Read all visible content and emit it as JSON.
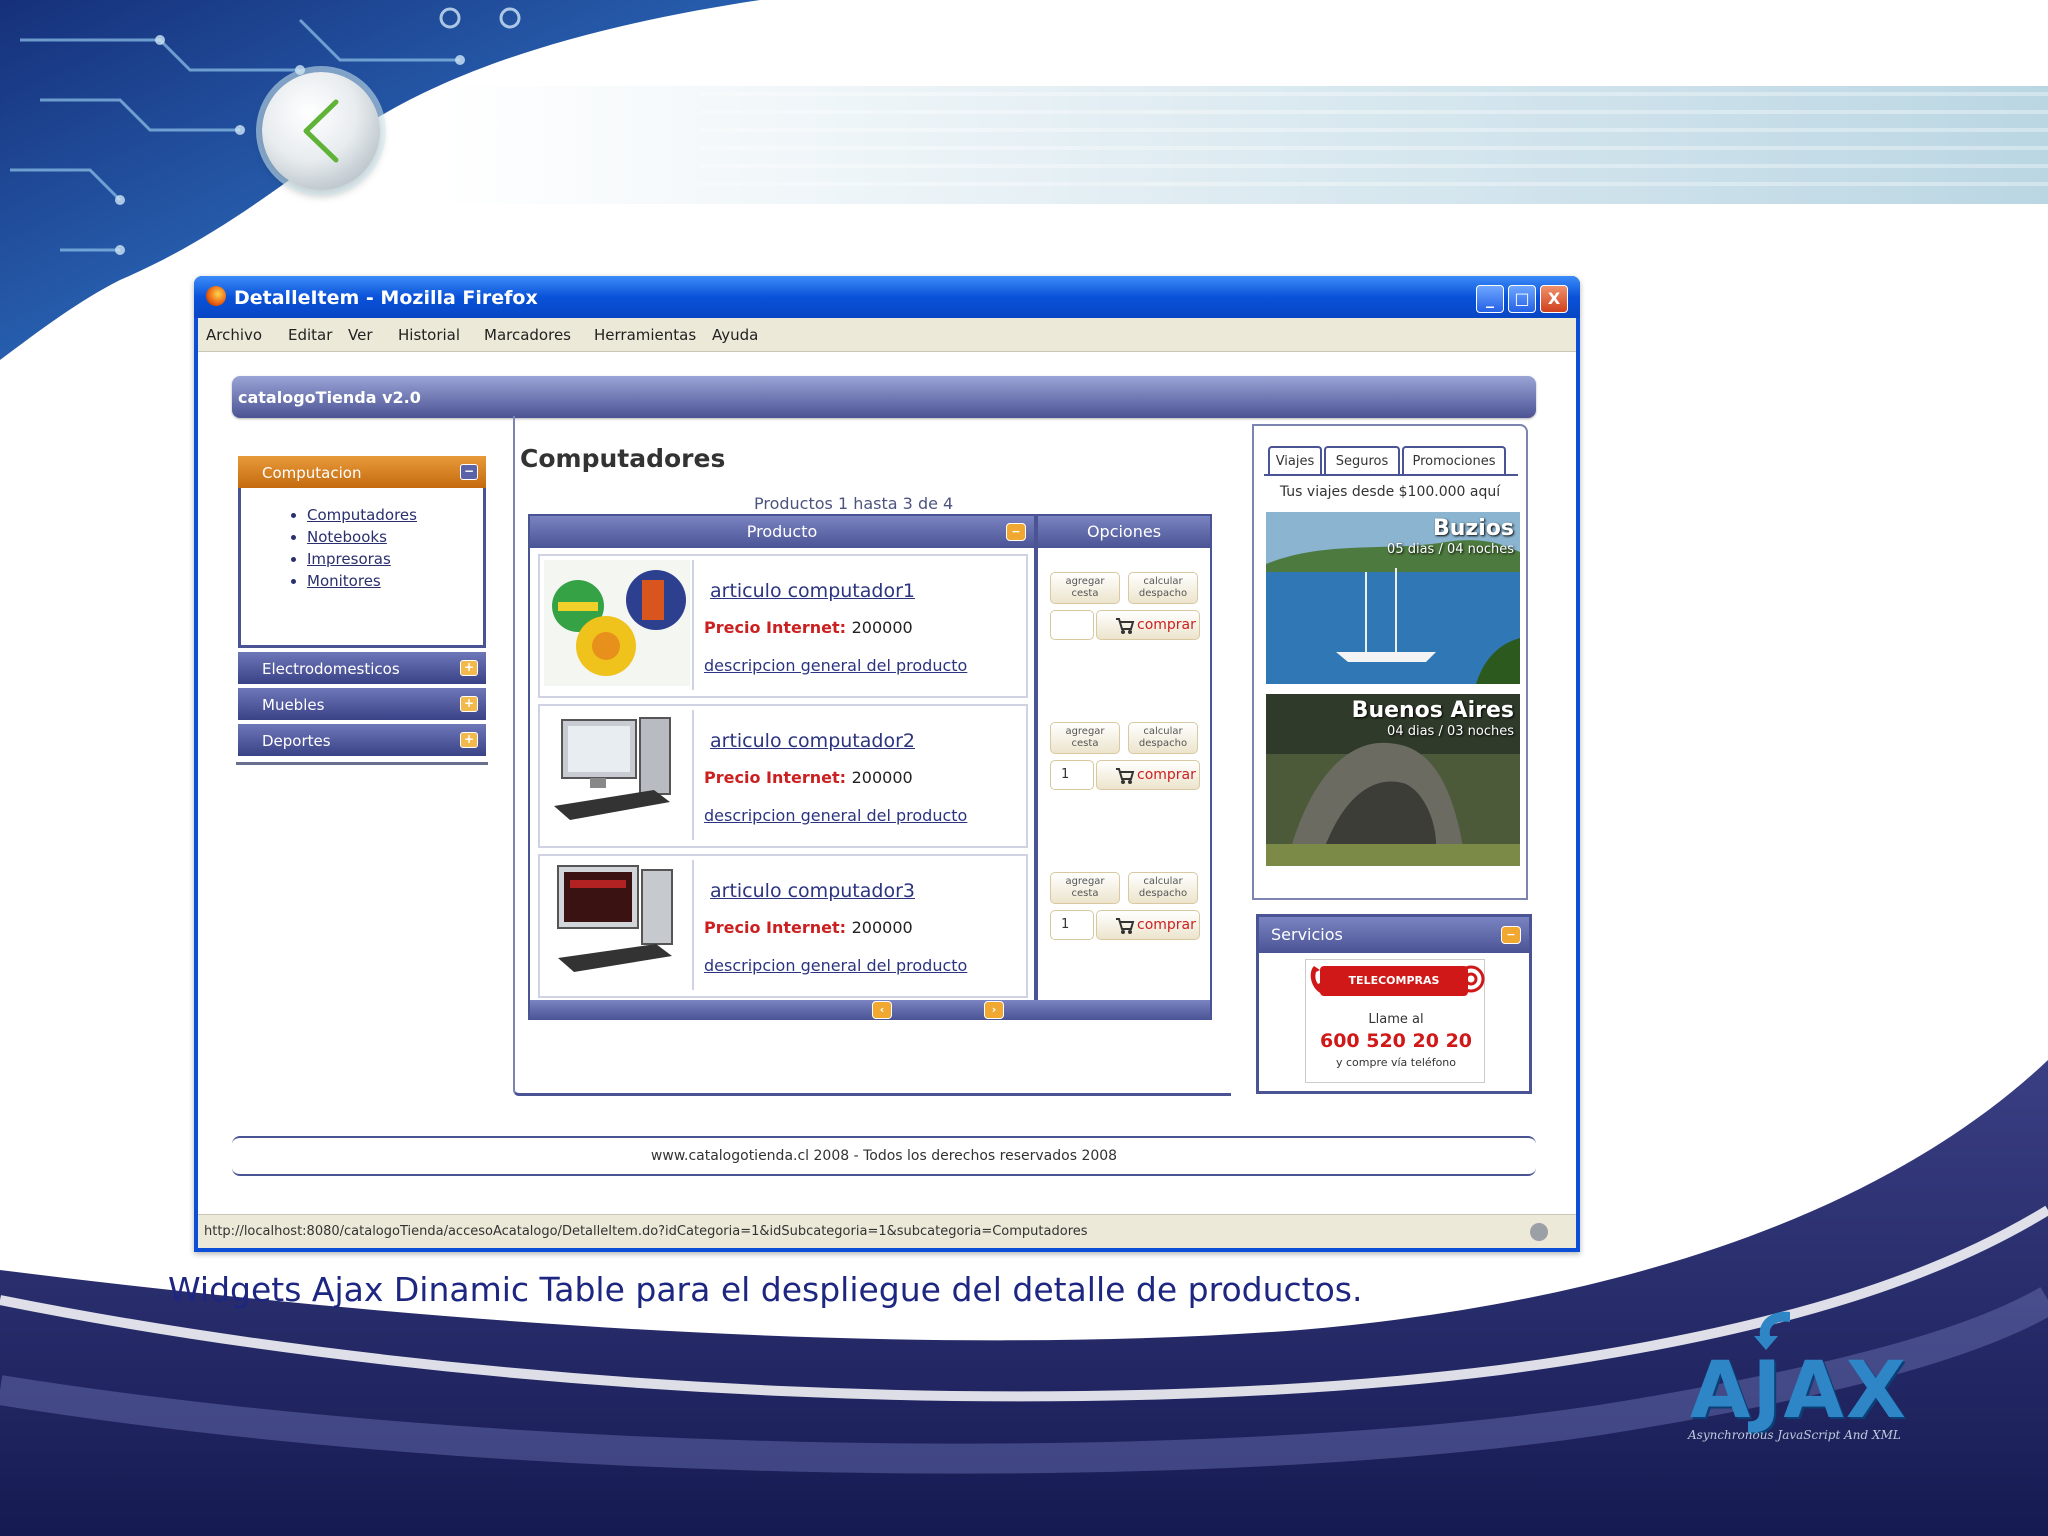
{
  "colors": {
    "slide_navy": "#1d2680",
    "window_blue": "#0a4fd6",
    "accent_orange": "#e0861e",
    "price_red": "#cc2020"
  },
  "slide": {
    "caption": "Widgets Ajax Dinamic Table para el despliegue del detalle de productos.",
    "back_icon": "chevron-left-icon",
    "logo_text": "AJAX",
    "logo_sub": "Asynchronous JavaScript And XML"
  },
  "browser": {
    "title": "DetalleItem - Mozilla Firefox",
    "buttons": {
      "minimize": "_",
      "maximize": "□",
      "close": "X"
    },
    "menu": [
      "Archivo",
      "Editar",
      "Ver",
      "Historial",
      "Marcadores",
      "Herramientas",
      "Ayuda"
    ],
    "status_url": "http://localhost:8080/catalogoTienda/accesoAcatalogo/DetalleItem.do?idCategoria=1&idSubcategoria=1&subcategoria=Computadores"
  },
  "app": {
    "title": "catalogoTienda v2.0",
    "footer": "www.catalogotienda.cl 2008 - Todos los derechos reservados 2008"
  },
  "leftnav": {
    "active_category": "Computacion",
    "active_toggle": "−",
    "subcategories": [
      "Computadores",
      "Notebooks",
      "Impresoras",
      "Monitores"
    ],
    "categories": [
      {
        "label": "Electrodomesticos",
        "toggle": "+"
      },
      {
        "label": "Muebles",
        "toggle": "+"
      },
      {
        "label": "Deportes",
        "toggle": "+"
      }
    ]
  },
  "main": {
    "title": "Computadores",
    "products_count": "Productos 1 hasta 3 de 4",
    "headers": {
      "product": "Producto",
      "options": "Opciones",
      "sort": "−"
    },
    "products": [
      {
        "name": "articulo computador1",
        "price_label": "Precio Internet:",
        "price": "200000",
        "desc": "descripcion general del producto"
      },
      {
        "name": "articulo computador2",
        "price_label": "Precio Internet:",
        "price": "200000",
        "desc": "descripcion general del producto"
      },
      {
        "name": "articulo computador3",
        "price_label": "Precio Internet:",
        "price": "200000",
        "desc": "descripcion general del producto"
      }
    ],
    "option_labels": {
      "btn1": "agregar cesta",
      "btn2": "calcular despacho",
      "qty": "1",
      "buy": "comprar"
    },
    "pager": {
      "prev": "‹",
      "next": "›"
    }
  },
  "right": {
    "tabs": [
      "Viajes",
      "Seguros",
      "Promociones"
    ],
    "promo_caption": "Tus viajes desde $100.000 aquí",
    "photos": [
      {
        "title": "Buzios",
        "sub": "05 dias / 04 noches"
      },
      {
        "title": "Buenos Aires",
        "sub": "04 dias / 03 noches"
      }
    ],
    "services": {
      "title": "Servicios",
      "toggle": "−",
      "tele_brand": "TELECOMPRAS",
      "call": "Llame al",
      "number": "600 520 20 20",
      "sub": "y compre vía teléfono"
    }
  }
}
